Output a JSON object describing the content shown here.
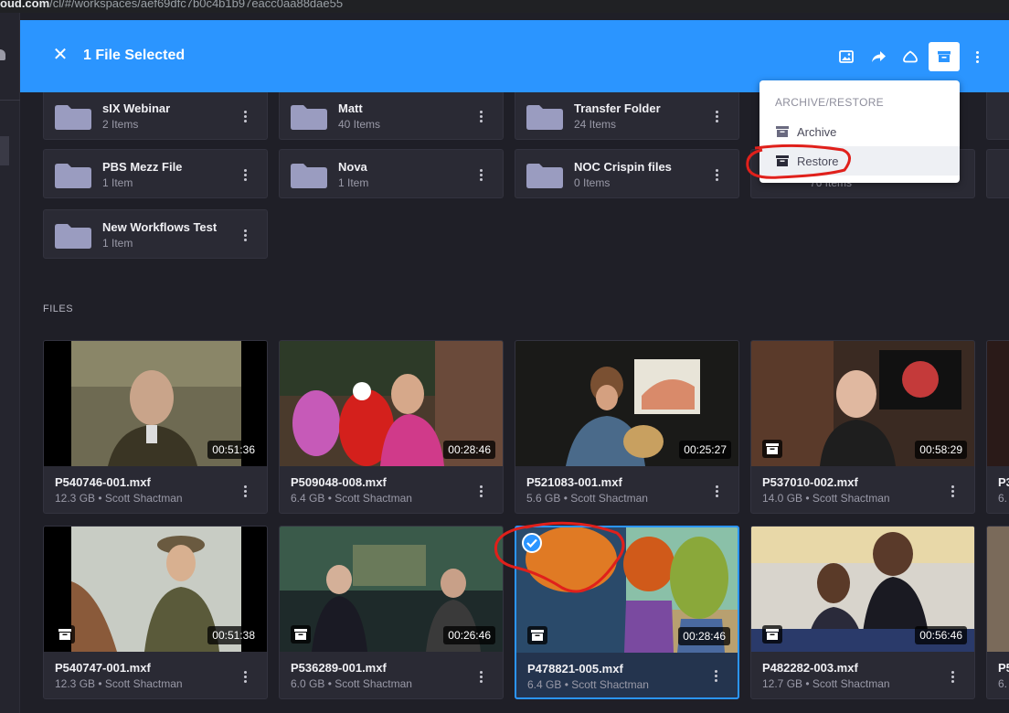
{
  "browser": {
    "url_host": "oud.com",
    "url_path": "/cl/#/workspaces/aef69dfc7b0c4b1b97eacc0aa88dae55"
  },
  "header": {
    "title": "1 File Selected"
  },
  "menu": {
    "heading": "ARCHIVE/RESTORE",
    "items": [
      {
        "label": "Archive"
      },
      {
        "label": "Restore"
      }
    ]
  },
  "folders": [
    {
      "name": "sIX Webinar",
      "count": "2 Items"
    },
    {
      "name": "Matt",
      "count": "40 Items"
    },
    {
      "name": "Transfer Folder",
      "count": "24 Items"
    },
    {
      "name": "PBS Mezz File",
      "count": "1 Item"
    },
    {
      "name": "Nova",
      "count": "1 Item"
    },
    {
      "name": "NOC Crispin files",
      "count": "0 Items"
    },
    {
      "name": "",
      "count": "76 Items"
    },
    {
      "name": "New Workflows Test",
      "count": "1 Item"
    }
  ],
  "files_section": "FILES",
  "files": [
    {
      "name": "P540746-001.mxf",
      "meta": "12.3 GB • Scott Shactman",
      "duration": "00:51:36"
    },
    {
      "name": "P509048-008.mxf",
      "meta": "6.4 GB • Scott Shactman",
      "duration": "00:28:46"
    },
    {
      "name": "P521083-001.mxf",
      "meta": "5.6 GB • Scott Shactman",
      "duration": "00:25:27"
    },
    {
      "name": "P537010-002.mxf",
      "meta": "14.0 GB • Scott Shactman",
      "duration": "00:58:29"
    },
    {
      "name": "P540747-001.mxf",
      "meta": "12.3 GB • Scott Shactman",
      "duration": "00:51:38"
    },
    {
      "name": "P536289-001.mxf",
      "meta": "6.0 GB • Scott Shactman",
      "duration": "00:26:46"
    },
    {
      "name": "P478821-005.mxf",
      "meta": "6.4 GB • Scott Shactman",
      "duration": "00:28:46"
    },
    {
      "name": "P482282-003.mxf",
      "meta": "12.7 GB • Scott Shactman",
      "duration": "00:56:46"
    }
  ],
  "partial_cards": [
    {
      "name": "P3",
      "meta": "6."
    },
    {
      "name": "P5",
      "meta": "6."
    }
  ],
  "colors": {
    "accent": "#2b95ff",
    "annotation": "#e0201b",
    "background": "#1f1f27",
    "card": "#2a2a34"
  }
}
